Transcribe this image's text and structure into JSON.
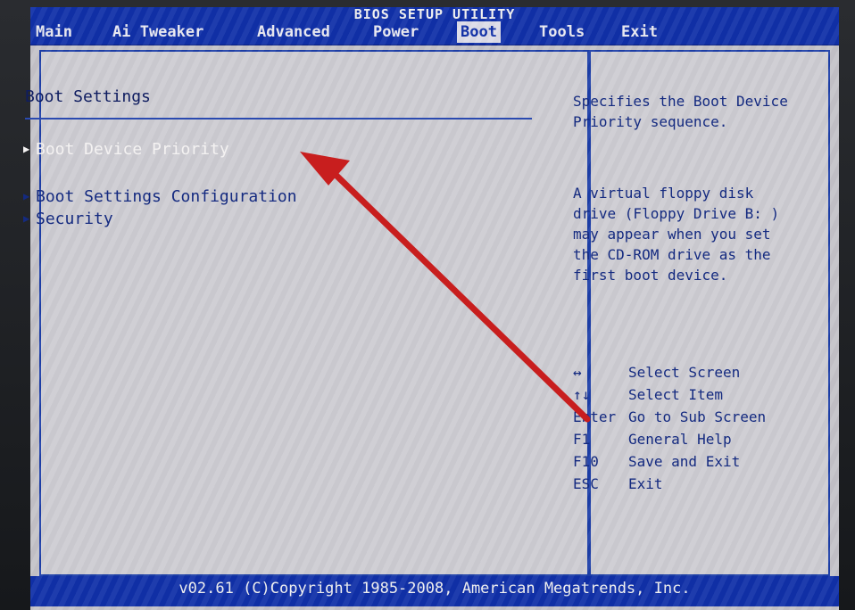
{
  "window": {
    "title": "BIOS SETUP UTILITY"
  },
  "menu": {
    "tabs": [
      {
        "label": "Main"
      },
      {
        "label": "Ai Tweaker"
      },
      {
        "label": "Advanced"
      },
      {
        "label": "Power"
      },
      {
        "label": "Boot"
      },
      {
        "label": "Tools"
      },
      {
        "label": "Exit"
      }
    ],
    "active": "Boot"
  },
  "main": {
    "section_title": "Boot Settings",
    "items": [
      {
        "label": "Boot Device Priority",
        "highlighted": true
      },
      {
        "label": "Boot Settings Configuration",
        "highlighted": false
      },
      {
        "label": "Security",
        "highlighted": false
      }
    ]
  },
  "help": {
    "description": "Specifies the Boot Device Priority sequence.",
    "note": "A virtual floppy disk drive (Floppy Drive B: ) may appear when you set the CD-ROM drive as the first boot device.",
    "keys": [
      {
        "key": "↔",
        "action": "Select Screen"
      },
      {
        "key": "↑↓",
        "action": "Select Item"
      },
      {
        "key": "Enter",
        "action": "Go to Sub Screen"
      },
      {
        "key": "F1",
        "action": "General Help"
      },
      {
        "key": "F10",
        "action": "Save and Exit"
      },
      {
        "key": "ESC",
        "action": "Exit"
      }
    ]
  },
  "footer": {
    "text": "v02.61 (C)Copyright 1985-2008, American Megatrends, Inc."
  },
  "colors": {
    "bar_blue": "#1030a8",
    "text_blue": "#142a80",
    "highlight_text": "#f4f2f2",
    "annotation_arrow": "#c81e1e"
  }
}
